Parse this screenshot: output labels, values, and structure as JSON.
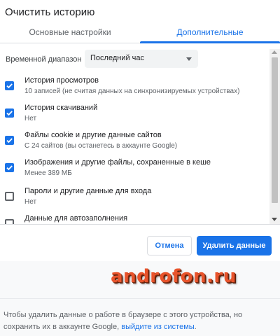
{
  "dialog": {
    "title": "Очистить историю"
  },
  "tabs": [
    {
      "label": "Основные настройки",
      "active": false
    },
    {
      "label": "Дополнительные",
      "active": true
    }
  ],
  "time_range": {
    "label": "Временной диапазон",
    "selected": "Последний час"
  },
  "items": [
    {
      "title": "История просмотров",
      "subtitle": "10 записей (не считая данных на синхронизируемых устройствах)",
      "checked": true
    },
    {
      "title": "История скачиваний",
      "subtitle": "Нет",
      "checked": true
    },
    {
      "title": "Файлы cookie и другие данные сайтов",
      "subtitle": "С 24 сайтов (вы останетесь в аккаунте Google)",
      "checked": true
    },
    {
      "title": "Изображения и другие файлы, сохраненные в кеше",
      "subtitle": "Менее 389 МБ",
      "checked": true
    },
    {
      "title": "Пароли и другие данные для входа",
      "subtitle": "Нет",
      "checked": false
    },
    {
      "title": "Данные для автозаполнения",
      "subtitle": "",
      "checked": false
    }
  ],
  "buttons": {
    "cancel": "Отмена",
    "delete": "Удалить данные"
  },
  "footer": {
    "text": "Чтобы удалить данные о работе в браузере с этого устройства, но сохранить их в аккаунте Google, ",
    "link": "выйдите из системы",
    "end": "."
  },
  "watermark": "androfon.ru",
  "colors": {
    "accent": "#1a73e8",
    "watermark": "#e8542c"
  }
}
